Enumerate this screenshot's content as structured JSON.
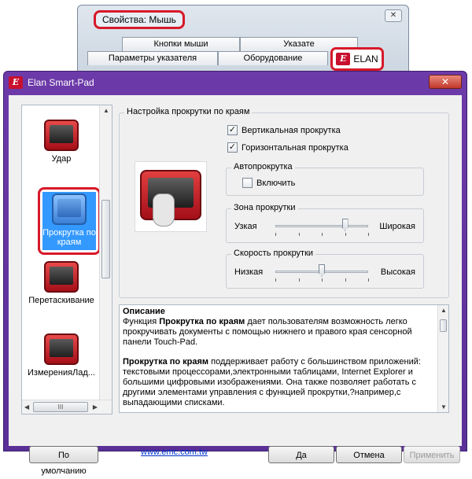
{
  "background_window": {
    "title": "Свойства: Мышь",
    "close_glyph": "✕",
    "tabs_row1": [
      "Кнопки мыши",
      "Указате"
    ],
    "tabs_row2": [
      "Параметры указателя",
      "Оборудование"
    ],
    "elan_tab": "ELAN"
  },
  "main_window": {
    "logo_glyph": "E",
    "title": "Elan Smart-Pad",
    "close_glyph": "✕"
  },
  "icon_list": {
    "items": [
      {
        "label": "Удар",
        "icon": "tap-icon"
      },
      {
        "label": "Прокрутка по краям",
        "icon": "edge-scroll-icon",
        "selected": true
      },
      {
        "label": "Перетаскивание",
        "icon": "drag-icon"
      },
      {
        "label": "ИзмеренияЛад...",
        "icon": "measure-icon"
      }
    ],
    "hscroll_thumb": "III"
  },
  "settings": {
    "group_title": "Настройка прокрутки по краям",
    "vertical_scroll": {
      "label": "Вертикальная прокрутка",
      "checked": true
    },
    "horizontal_scroll": {
      "label": "Горизонтальная прокрутка",
      "checked": true
    },
    "autoscroll": {
      "title": "Автопрокрутка",
      "enable": {
        "label": "Включить",
        "checked": false
      }
    },
    "zone": {
      "title": "Зона прокрутки",
      "min_label": "Узкая",
      "max_label": "Широкая",
      "value": 0.75
    },
    "speed": {
      "title": "Скорость прокрутки",
      "min_label": "Низкая",
      "max_label": "Высокая",
      "value": 0.5
    }
  },
  "description": {
    "heading": "Описание",
    "p1_prefix": "Функция  ",
    "p1_bold": "Прокрутка по краям",
    "p1_rest": " дает пользователям возможность легко прокручивать документы с помощью нижнего и правого края сенсорной панели Touch-Pad.",
    "p2_bold": "Прокрутка по краям",
    "p2_rest": " поддерживает работу с большинством приложений: текстовыми процессорами,электронными таблицами, Internet Explorer и большими цифровыми изображениями. Она также позволяет работать с другими элементами управления с функцией прокрутки,?например,с выпадающими списками."
  },
  "footer": {
    "default_button": "По умолчанию",
    "link": "www.emc.com.tw",
    "ok_button": "Да",
    "cancel_button": "Отмена",
    "apply_button": "Применить"
  },
  "colors": {
    "accent_red": "#d7192a",
    "title_purple": "#6d3aa9",
    "selection_blue": "#3399ff"
  }
}
